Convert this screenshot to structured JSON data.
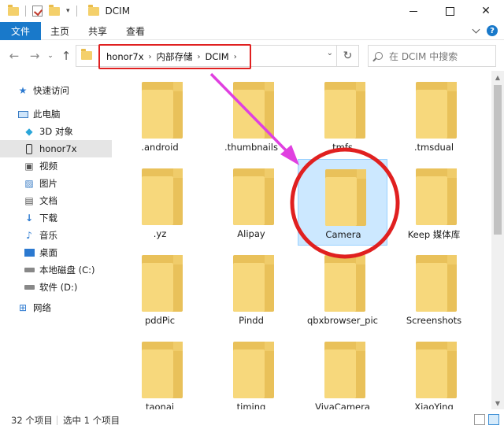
{
  "window": {
    "title": "DCIM",
    "controls": [
      "minimize",
      "maximize",
      "close"
    ]
  },
  "ribbon": {
    "file_tab": "文件",
    "tabs": [
      "主页",
      "共享",
      "查看"
    ]
  },
  "address": {
    "crumbs": [
      "honor7x",
      "内部存储",
      "DCIM"
    ],
    "separator": "›",
    "dropdown": "⌄",
    "refresh": "↻"
  },
  "search": {
    "placeholder": "在 DCIM 中搜索"
  },
  "sidebar": {
    "quick_access": "快速访问",
    "this_pc": "此电脑",
    "items": [
      {
        "label": "3D 对象",
        "icon": "3d-objects-icon"
      },
      {
        "label": "honor7x",
        "icon": "phone-icon",
        "selected": true
      },
      {
        "label": "视频",
        "icon": "video-icon"
      },
      {
        "label": "图片",
        "icon": "pictures-icon"
      },
      {
        "label": "文档",
        "icon": "documents-icon"
      },
      {
        "label": "下载",
        "icon": "downloads-icon"
      },
      {
        "label": "音乐",
        "icon": "music-icon"
      },
      {
        "label": "桌面",
        "icon": "desktop-icon"
      },
      {
        "label": "本地磁盘 (C:)",
        "icon": "drive-icon"
      },
      {
        "label": "软件 (D:)",
        "icon": "drive-icon"
      }
    ],
    "network": "网络"
  },
  "folders": [
    {
      "name": ".android"
    },
    {
      "name": ".thumbnails"
    },
    {
      "name": "tmfs"
    },
    {
      "name": ".tmsdual"
    },
    {
      "name": ".yz"
    },
    {
      "name": "Alipay"
    },
    {
      "name": "Camera",
      "selected": true
    },
    {
      "name": "Keep 媒体库"
    },
    {
      "name": "pddPic"
    },
    {
      "name": "Pindd"
    },
    {
      "name": "qbxbrowser_pic"
    },
    {
      "name": "Screenshots"
    },
    {
      "name": "taonai"
    },
    {
      "name": "timing"
    },
    {
      "name": "VivaCamera"
    },
    {
      "name": "XiaoYing"
    }
  ],
  "status": {
    "count": "32 个项目",
    "selected": "选中 1 个项目"
  },
  "annotation": {
    "color": "#e02020",
    "arrow_color": "#e040e0"
  }
}
